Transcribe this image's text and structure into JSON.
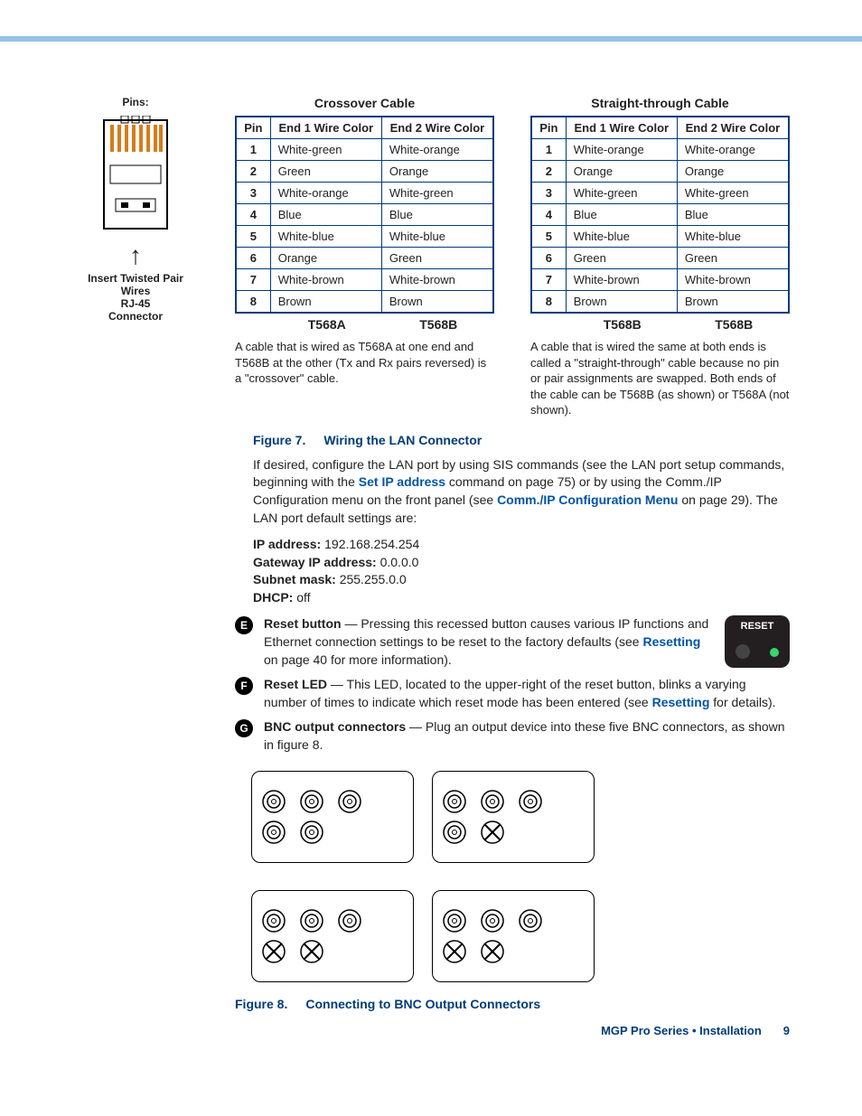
{
  "pins": {
    "title": "Pins:",
    "caption1": "Insert Twisted Pair Wires",
    "caption2a": "RJ-45",
    "caption2b": "Connector"
  },
  "crossover": {
    "title": "Crossover Cable",
    "headers": {
      "pin": "Pin",
      "e1": "End 1 Wire Color",
      "e2": "End 2 Wire Color"
    },
    "rows": [
      {
        "pin": "1",
        "e1": "White-green",
        "e2": "White-orange"
      },
      {
        "pin": "2",
        "e1": "Green",
        "e2": "Orange"
      },
      {
        "pin": "3",
        "e1": "White-orange",
        "e2": "White-green"
      },
      {
        "pin": "4",
        "e1": "Blue",
        "e2": "Blue"
      },
      {
        "pin": "5",
        "e1": "White-blue",
        "e2": "White-blue"
      },
      {
        "pin": "6",
        "e1": "Orange",
        "e2": "Green"
      },
      {
        "pin": "7",
        "e1": "White-brown",
        "e2": "White-brown"
      },
      {
        "pin": "8",
        "e1": "Brown",
        "e2": "Brown"
      }
    ],
    "std1": "T568A",
    "std2": "T568B",
    "note": "A cable that is wired as T568A at one end and T568B at the other (Tx and Rx pairs reversed) is a \"crossover\" cable."
  },
  "straight": {
    "title": "Straight-through Cable",
    "headers": {
      "pin": "Pin",
      "e1": "End 1 Wire Color",
      "e2": "End 2 Wire Color"
    },
    "rows": [
      {
        "pin": "1",
        "e1": "White-orange",
        "e2": "White-orange"
      },
      {
        "pin": "2",
        "e1": "Orange",
        "e2": "Orange"
      },
      {
        "pin": "3",
        "e1": "White-green",
        "e2": "White-green"
      },
      {
        "pin": "4",
        "e1": "Blue",
        "e2": "Blue"
      },
      {
        "pin": "5",
        "e1": "White-blue",
        "e2": "White-blue"
      },
      {
        "pin": "6",
        "e1": "Green",
        "e2": "Green"
      },
      {
        "pin": "7",
        "e1": "White-brown",
        "e2": "White-brown"
      },
      {
        "pin": "8",
        "e1": "Brown",
        "e2": "Brown"
      }
    ],
    "std1": "T568B",
    "std2": "T568B",
    "note": "A cable that is wired the same at both ends is called a \"straight-through\" cable because no pin or pair assignments are swapped. Both ends of the cable can be T568B (as shown) or T568A (not shown)."
  },
  "fig7": {
    "num": "Figure 7.",
    "title": "Wiring the LAN Connector"
  },
  "para1a": "If desired, configure the LAN port by using SIS commands (see the LAN port setup commands, beginning with the ",
  "link1": "Set IP address",
  "para1b": " command on page 75) or by using the Comm./IP Configuration menu on the front panel (see ",
  "link2": "Comm./IP Configuration Menu",
  "para1c": " on page 29). The LAN port default settings are:",
  "settings": {
    "ip_l": "IP address:",
    "ip_v": "192.168.254.254",
    "gw_l": "Gateway IP address:",
    "gw_v": "0.0.0.0",
    "sm_l": "Subnet mask:",
    "sm_v": "255.255.0.0",
    "dh_l": "DHCP:",
    "dh_v": "off"
  },
  "itemE": {
    "letter": "E",
    "head": "Reset button",
    "text1": " — Pressing this recessed button causes various IP functions and Ethernet connection settings to be reset to the factory defaults (see ",
    "link": "Resetting",
    "text2": " on page 40 for more information)."
  },
  "resetLabel": "RESET",
  "itemF": {
    "letter": "F",
    "head": "Reset LED",
    "text1": " — This LED, located to the upper-right of the reset button, blinks a varying number of times to indicate which reset mode has been entered (see ",
    "link": "Resetting",
    "text2": " for details)."
  },
  "itemG": {
    "letter": "G",
    "head": "BNC output connectors",
    "text": " — Plug an output device into these five BNC connectors, as shown in figure 8."
  },
  "panels": [
    {
      "row1": [
        "o",
        "o",
        "o"
      ],
      "row2": [
        "o",
        "o"
      ]
    },
    {
      "row1": [
        "o",
        "o",
        "o"
      ],
      "row2": [
        "o",
        "x"
      ]
    },
    {
      "row1": [
        "o",
        "o",
        "o"
      ],
      "row2": [
        "x",
        "x"
      ]
    },
    {
      "row1": [
        "o",
        "o",
        "o"
      ],
      "row2": [
        "x",
        "x"
      ]
    }
  ],
  "fig8": {
    "num": "Figure 8.",
    "title": "Connecting to BNC Output Connectors"
  },
  "footer": {
    "doc": "MGP Pro Series • Installation",
    "page": "9"
  }
}
